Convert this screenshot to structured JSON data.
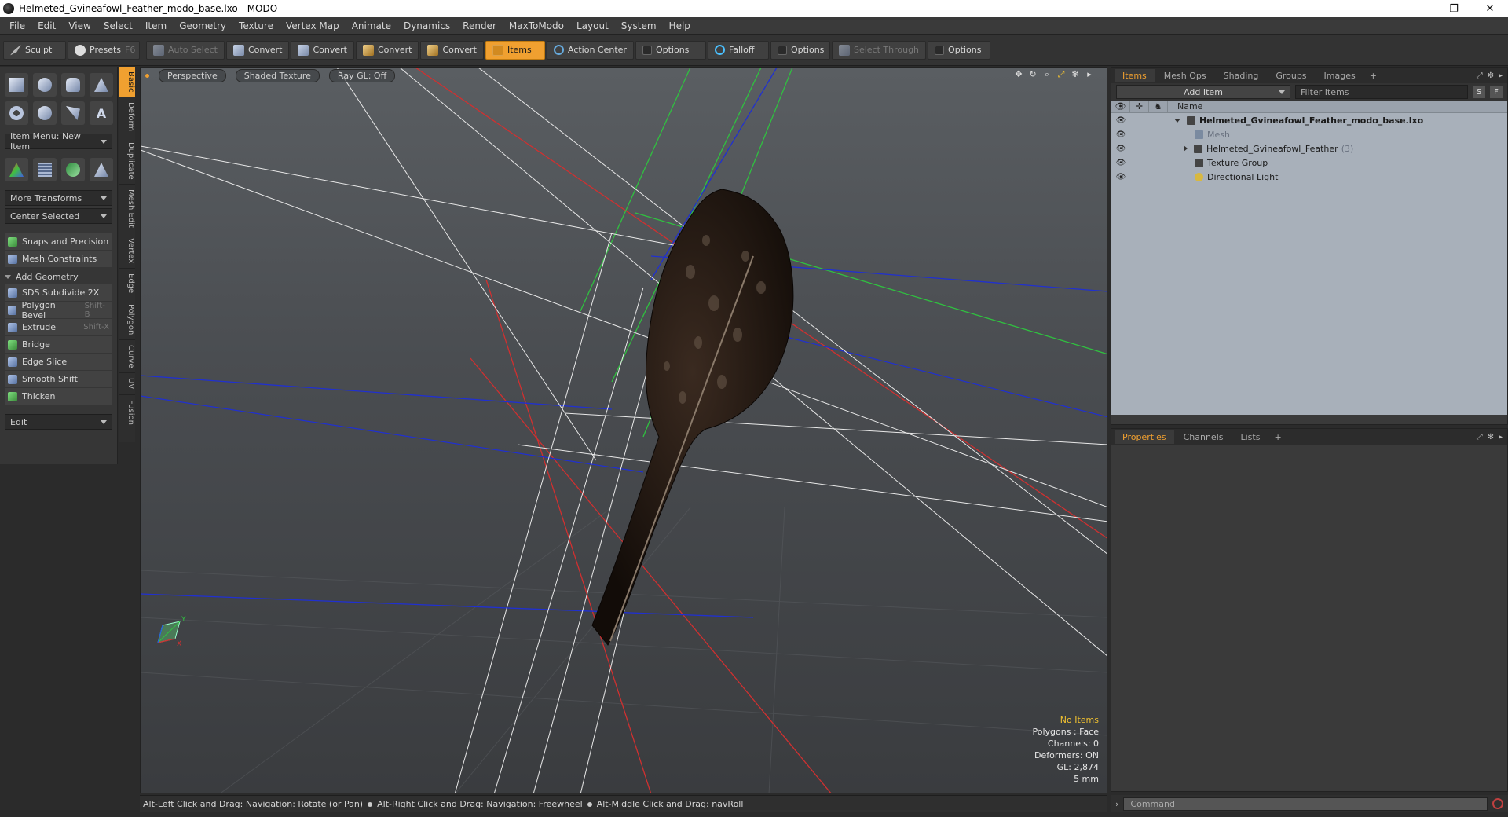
{
  "window": {
    "title": "Helmeted_Gvineafowl_Feather_modo_base.lxo - MODO",
    "controls": [
      "—",
      "❐",
      "✕"
    ]
  },
  "menu": [
    "File",
    "Edit",
    "View",
    "Select",
    "Item",
    "Geometry",
    "Texture",
    "Vertex Map",
    "Animate",
    "Dynamics",
    "Render",
    "MaxToModo",
    "Layout",
    "System",
    "Help"
  ],
  "toolbar": {
    "sculpt": "Sculpt",
    "presets": "Presets",
    "presets_key": "F6",
    "auto_select": "Auto Select",
    "convert1": "Convert",
    "convert2": "Convert",
    "convert3": "Convert",
    "convert4": "Convert",
    "items": "Items",
    "action_center": "Action Center",
    "options1": "Options",
    "falloff": "Falloff",
    "options2": "Options",
    "select_through": "Select Through",
    "options3": "Options"
  },
  "left_panel": {
    "item_menu": "Item Menu: New Item",
    "more_transforms": "More Transforms",
    "center_selected": "Center Selected",
    "snaps": "Snaps and Precision",
    "mesh_constraints": "Mesh Constraints",
    "add_geometry": "Add Geometry",
    "tools": [
      {
        "label": "SDS Subdivide 2X",
        "shortcut": ""
      },
      {
        "label": "Polygon Bevel",
        "shortcut": "Shift-B"
      },
      {
        "label": "Extrude",
        "shortcut": "Shift-X"
      },
      {
        "label": "Bridge",
        "shortcut": ""
      },
      {
        "label": "Edge Slice",
        "shortcut": ""
      },
      {
        "label": "Smooth Shift",
        "shortcut": ""
      },
      {
        "label": "Thicken",
        "shortcut": ""
      }
    ],
    "edit": "Edit"
  },
  "side_tabs": [
    "Basic",
    "Deform",
    "Duplicate",
    "Mesh Edit",
    "Vertex",
    "Edge",
    "Polygon",
    "Curve",
    "UV",
    "Fusion"
  ],
  "viewport": {
    "view": "Perspective",
    "shading": "Shaded Texture",
    "raygl": "Ray GL: Off",
    "info": {
      "selection": "No Items",
      "polygons": "Polygons : Face",
      "channels": "Channels: 0",
      "deformers": "Deformers: ON",
      "gl": "GL: 2,874",
      "scale": "5 mm"
    },
    "axis_x": "X",
    "axis_y": "Y"
  },
  "status": {
    "hint1": "Alt-Left Click and Drag: Navigation: Rotate (or Pan)",
    "hint2": "Alt-Right Click and Drag: Navigation: Freewheel",
    "hint3": "Alt-Middle Click and Drag: navRoll"
  },
  "items_panel": {
    "tabs": [
      "Items",
      "Mesh Ops",
      "Shading",
      "Groups",
      "Images"
    ],
    "add_item": "Add Item",
    "filter_placeholder": "Filter Items",
    "btn_s": "S",
    "btn_f": "F",
    "name_col": "Name",
    "scene": "Helmeted_Gvineafowl_Feather_modo_base.lxo",
    "rows": [
      {
        "label": "Mesh",
        "count": ""
      },
      {
        "label": "Helmeted_Gvineafowl_Feather",
        "count": "(3)"
      },
      {
        "label": "Texture Group",
        "count": ""
      },
      {
        "label": "Directional Light",
        "count": ""
      }
    ]
  },
  "props_panel": {
    "tabs": [
      "Properties",
      "Channels",
      "Lists"
    ]
  },
  "command": {
    "placeholder": "Command"
  }
}
